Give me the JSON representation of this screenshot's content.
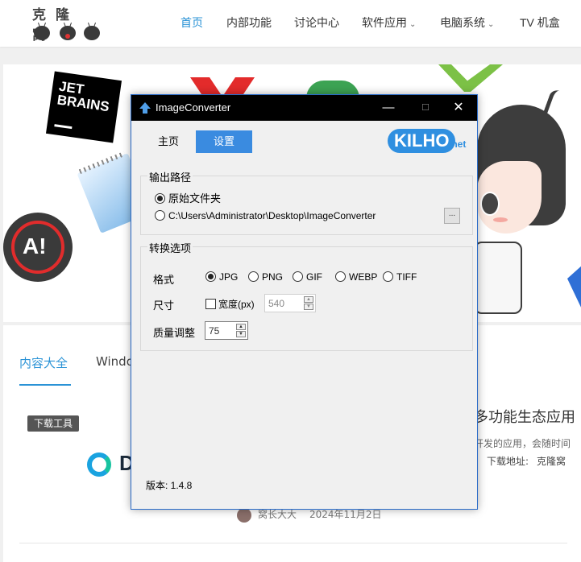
{
  "site": {
    "logo_text": "克隆窝",
    "nav": [
      {
        "label": "首页",
        "active": true,
        "dropdown": false
      },
      {
        "label": "内部功能",
        "active": false,
        "dropdown": false
      },
      {
        "label": "讨论中心",
        "active": false,
        "dropdown": false
      },
      {
        "label": "软件应用",
        "active": false,
        "dropdown": true
      },
      {
        "label": "电脑系统",
        "active": false,
        "dropdown": true
      },
      {
        "label": "TV 机盒",
        "active": false,
        "dropdown": false
      }
    ],
    "accent_color": "#2b93d6"
  },
  "banner": {
    "jetbrains_text": "JET\nBRAINS",
    "ai_badge_text": "A!"
  },
  "content": {
    "tabs": [
      "内容大全",
      "Windo"
    ],
    "tag": "下载工具",
    "logo_letter": "D",
    "article_title": "多功能生态应用",
    "article_desc": "开发的应用，会随时间",
    "download_label": "下载地址:",
    "download_value": "克隆窝",
    "author": "窝长大大",
    "date": "2024年11月2日"
  },
  "window": {
    "title": "ImageConverter",
    "controls": {
      "min": "—",
      "max": "☐",
      "close": "✕"
    },
    "tabs": {
      "home": "主页",
      "settings": "设置"
    },
    "brand": {
      "main": "KILHO",
      "suffix": ".net"
    },
    "output": {
      "legend": "输出路径",
      "option_original": "原始文件夹",
      "option_custom": "C:\\Users\\Administrator\\Desktop\\ImageConverter",
      "selected": "original",
      "browse": "..."
    },
    "convert": {
      "legend": "转换选项",
      "format_label": "格式",
      "formats": [
        "JPG",
        "PNG",
        "GIF",
        "WEBP",
        "TIFF"
      ],
      "selected_format": "JPG",
      "size_label": "尺寸",
      "width_checkbox": "宽度(px)",
      "width_value": "540",
      "quality_label": "质量调整",
      "quality_value": "75"
    },
    "version": "版本: 1.4.8"
  }
}
